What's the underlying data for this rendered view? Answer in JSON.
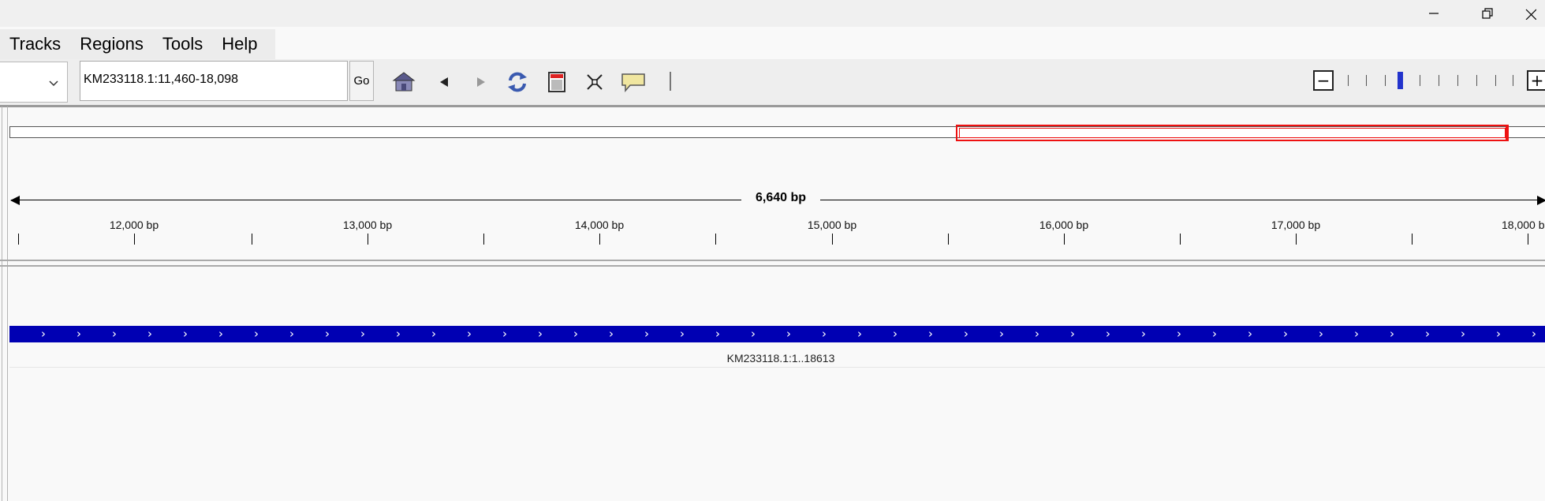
{
  "window": {
    "controls": [
      "minimize",
      "restore",
      "close"
    ]
  },
  "menu": [
    "Tracks",
    "Regions",
    "Tools",
    "Help"
  ],
  "toolbar": {
    "locus": "KM233118.1:11,460-18,098",
    "go_label": "Go",
    "tools": [
      "home-icon",
      "back-icon",
      "forward-icon",
      "refresh-icon",
      "region-of-interest-icon",
      "fit-to-window-icon",
      "popup-info-icon"
    ],
    "zoom_minus": "−",
    "zoom_plus": "+"
  },
  "ruler": {
    "span_label": "6,640 bp",
    "tick_labels": [
      "12,000 bp",
      "13,000 bp",
      "14,000 bp",
      "15,000 bp",
      "16,000 bp",
      "17,000 bp",
      "18,000 b"
    ]
  },
  "feature": {
    "name": "KM233118.1:1..18613",
    "color": "#0000b3"
  },
  "colors": {
    "ideogram_highlight": "#ee1111",
    "zoom_current": "#2233cc"
  }
}
